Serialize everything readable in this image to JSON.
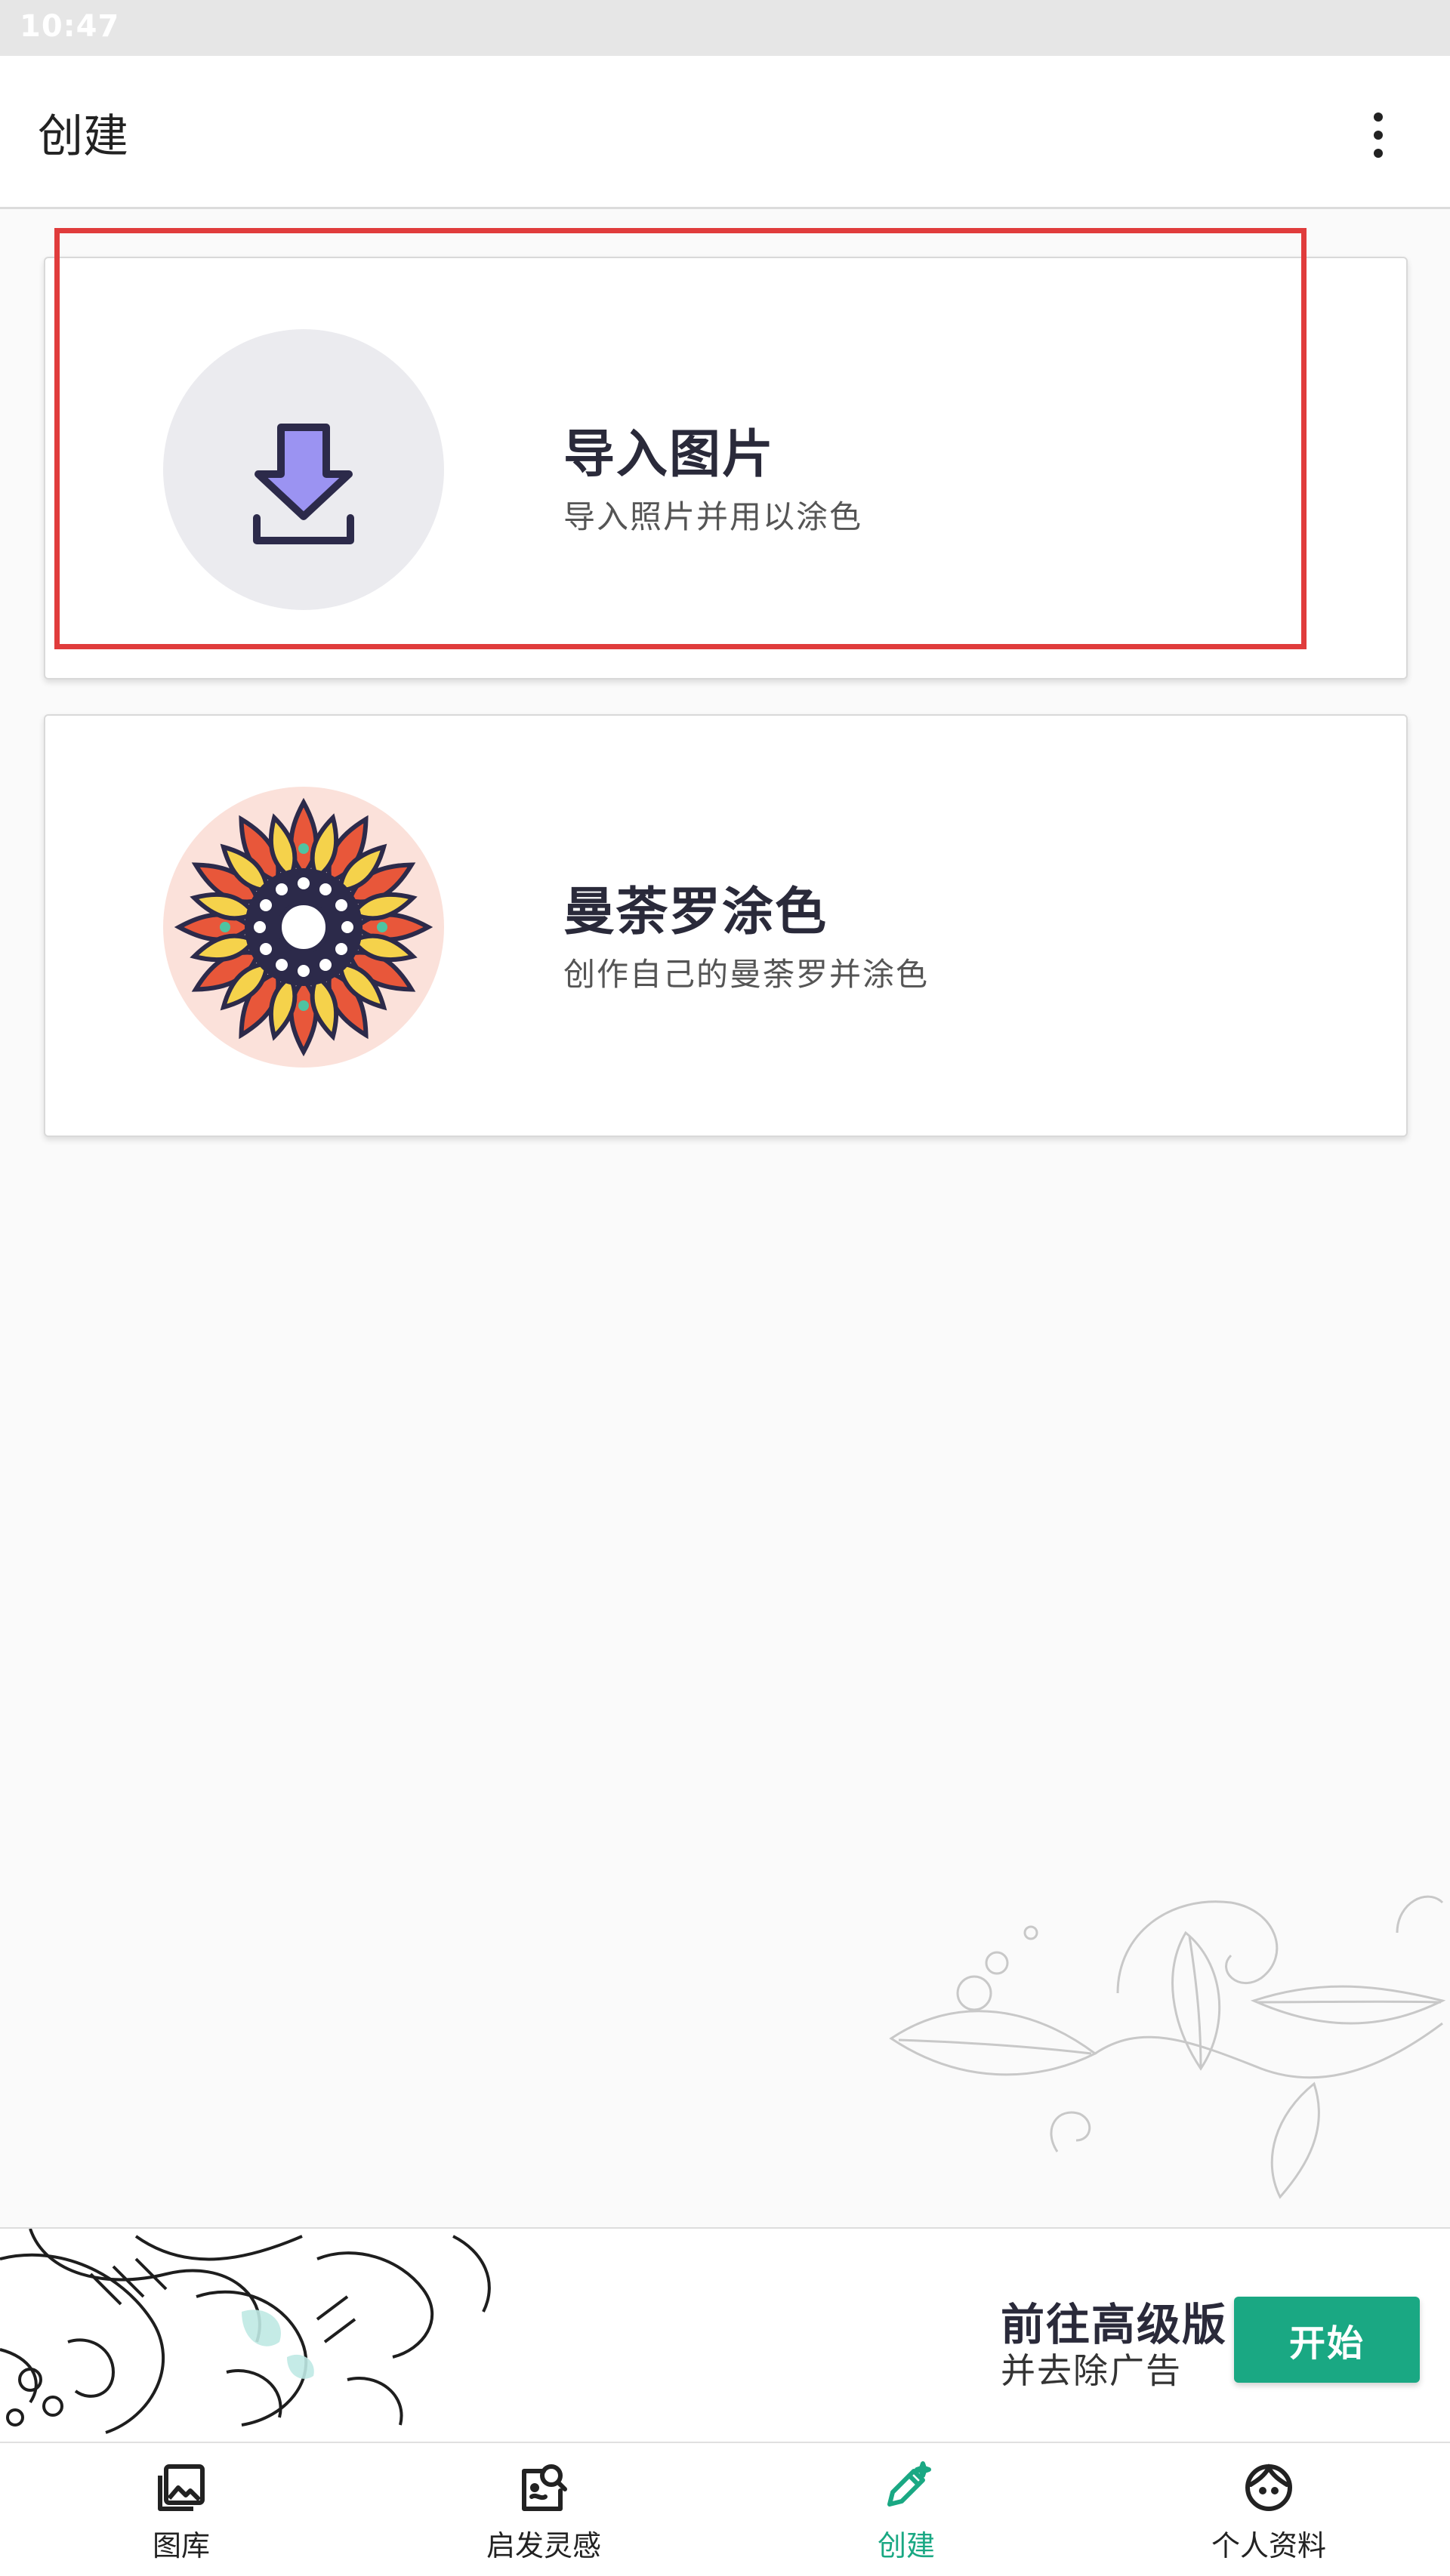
{
  "status_bar": {
    "time": "10:47"
  },
  "app_bar": {
    "title": "创建",
    "menu_icon": "more-vert-icon"
  },
  "cards": [
    {
      "title": "导入图片",
      "subtitle": "导入照片并用以涂色",
      "icon": "download-icon"
    },
    {
      "title": "曼荼罗涂色",
      "subtitle": "创作自己的曼荼罗并涂色",
      "icon": "mandala-icon"
    }
  ],
  "promo": {
    "title": "前往高级版",
    "subtitle": "并去除广告",
    "button_label": "开始",
    "button_color": "#1aa883"
  },
  "bottom_nav": {
    "items": [
      {
        "label": "图库",
        "icon": "gallery-icon",
        "active": false
      },
      {
        "label": "启发灵感",
        "icon": "inspiration-icon",
        "active": false
      },
      {
        "label": "创建",
        "icon": "pencil-icon",
        "active": true
      },
      {
        "label": "个人资料",
        "icon": "profile-icon",
        "active": false
      }
    ],
    "active_color": "#1aa883"
  },
  "highlight_color": "#e03c3c"
}
